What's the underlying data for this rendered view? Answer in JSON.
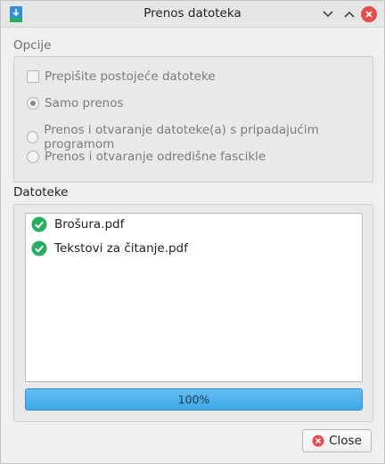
{
  "window": {
    "title": "Prenos datoteka",
    "icons": {
      "app": "download-document-icon",
      "minimize": "chevron-down-icon",
      "maximize": "chevron-up-icon",
      "close": "close-icon"
    },
    "colors": {
      "close_button": "#e64c4c",
      "accent": "#3ea7e6",
      "success": "#27ae60"
    }
  },
  "options": {
    "label": "Opcije",
    "overwrite_checkbox": {
      "label": "Prepišite postojeće datoteke",
      "checked": false
    },
    "radios": [
      {
        "label": "Samo prenos",
        "checked": true
      },
      {
        "label": "Prenos i otvaranje datoteke(a) s pripadajućim programom",
        "checked": false
      },
      {
        "label": "Prenos i otvaranje odredišne fascikle",
        "checked": false
      }
    ]
  },
  "files": {
    "label": "Datoteke",
    "items": [
      {
        "name": "Brošura.pdf",
        "status_icon": "check-circle-icon"
      },
      {
        "name": "Tekstovi za čitanje.pdf",
        "status_icon": "check-circle-icon"
      }
    ],
    "progress": {
      "text": "100%",
      "value": 1.0
    }
  },
  "footer": {
    "close_label": "Close",
    "close_icon": "cancel-icon"
  }
}
